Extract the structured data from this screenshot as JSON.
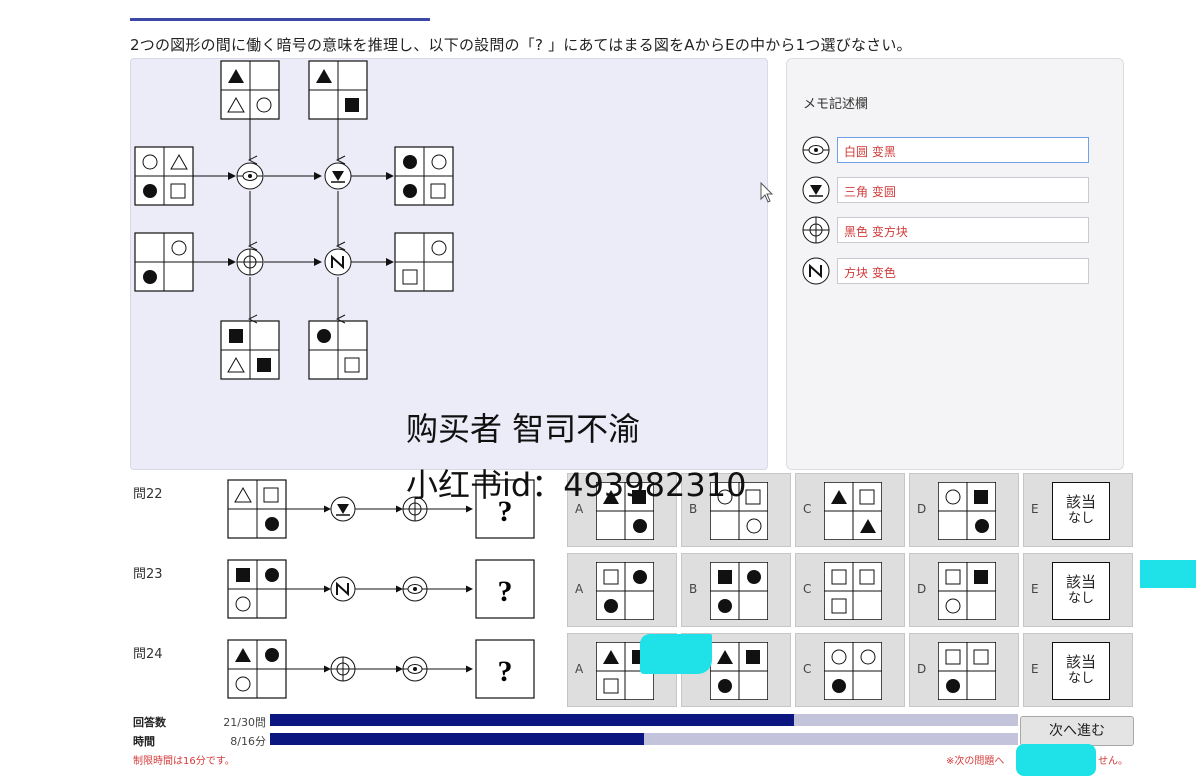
{
  "question_text": "2つの図形の間に働く暗号の意味を推理し、以下の設問の「? 」にあてはまる図をAからEの中から1つ選びなさい。",
  "memo": {
    "title": "メモ記述欄",
    "entries": [
      {
        "symbol": "circle-dot-icon",
        "text": "白圆 变黑"
      },
      {
        "symbol": "triangle-icon",
        "text": "三角 变圆"
      },
      {
        "symbol": "cross-icon",
        "text": "黑色 变方块"
      },
      {
        "symbol": "n-icon",
        "text": "方块 变色"
      }
    ]
  },
  "questions": [
    {
      "label": "問22",
      "unknown": "?",
      "choices": [
        {
          "letter": "A"
        },
        {
          "letter": "B"
        },
        {
          "letter": "C"
        },
        {
          "letter": "D"
        },
        {
          "letter": "E",
          "text_top": "該当",
          "text_bottom": "なし"
        }
      ]
    },
    {
      "label": "問23",
      "unknown": "?",
      "choices": [
        {
          "letter": "A"
        },
        {
          "letter": "B"
        },
        {
          "letter": "C"
        },
        {
          "letter": "D"
        },
        {
          "letter": "E",
          "text_top": "該当",
          "text_bottom": "なし"
        }
      ]
    },
    {
      "label": "問24",
      "unknown": "?",
      "choices": [
        {
          "letter": "A"
        },
        {
          "letter": "B"
        },
        {
          "letter": "C"
        },
        {
          "letter": "D"
        },
        {
          "letter": "E",
          "text_top": "該当",
          "text_bottom": "なし"
        }
      ]
    }
  ],
  "progress": {
    "answers_label": "回答数",
    "answers_count": "21/30問",
    "answers_fraction": 0.7,
    "time_label": "時間",
    "time_count": "8/16分",
    "time_fraction": 0.5,
    "limit_note": "制限時間は16分です。",
    "next_label": "次へ進む",
    "right_note_start": "※次の問題へ",
    "right_note_end": "せん。"
  },
  "watermark": {
    "line1": "购买者 智司不渝",
    "line2": "小红书id：493982310"
  },
  "colors": {
    "accent": "#0b1680",
    "memo_text": "#d23b3b",
    "panel_bg": "#ecebf8",
    "cyan_mark": "#1fe1e8"
  }
}
